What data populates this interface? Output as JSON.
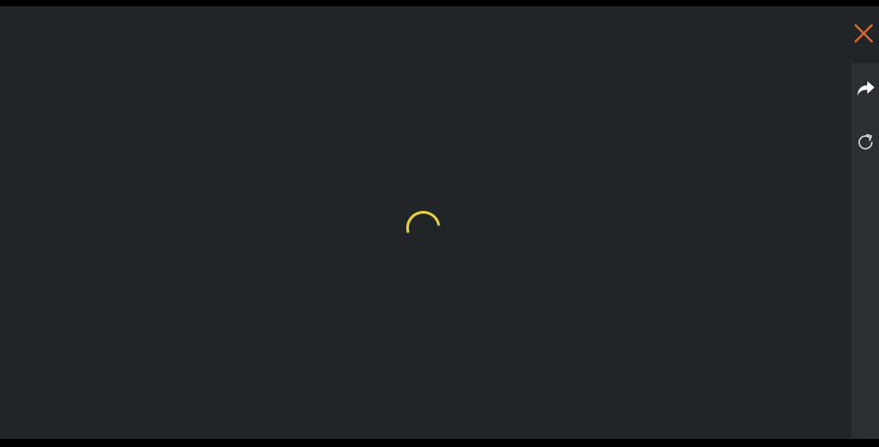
{
  "overlay": {
    "state": "loading",
    "background_color": "#222528",
    "rail_color": "#2c2f33",
    "spinner_color": "#e4cf47",
    "spinner_icon": "loading-spinner-icon"
  },
  "controls": {
    "close": {
      "icon": "close-icon",
      "color": "#d2642f"
    },
    "share": {
      "icon": "share-arrow-icon",
      "color": "#ffffff"
    },
    "reload": {
      "icon": "reload-icon",
      "color": "#d8d8d8"
    }
  }
}
